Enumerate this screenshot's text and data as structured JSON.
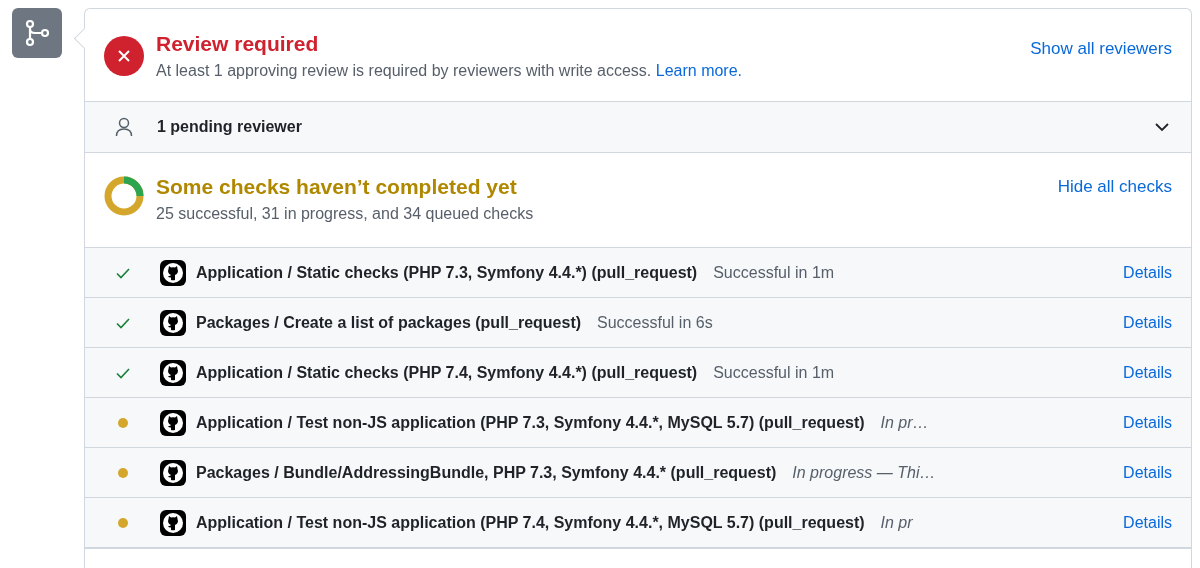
{
  "review": {
    "title": "Review required",
    "description": "At least 1 approving review is required by reviewers with write access.",
    "link": "Learn more.",
    "action": "Show all reviewers"
  },
  "pending": {
    "label": "1 pending reviewer",
    "expanded": false
  },
  "checks_summary": {
    "title": "Some checks haven’t completed yet",
    "description": "25 successful, 31 in progress, and 34 queued checks",
    "action": "Hide all checks"
  },
  "checks": [
    {
      "kind": "success",
      "name": "Application / Static checks (PHP 7.3, Symfony 4.4.*) (pull_request)",
      "detail": "Successful in 1m",
      "link": "Details"
    },
    {
      "kind": "success",
      "name": "Packages / Create a list of packages (pull_request)",
      "detail": "Successful in 6s",
      "link": "Details"
    },
    {
      "kind": "success",
      "name": "Application / Static checks (PHP 7.4, Symfony 4.4.*) (pull_request)",
      "detail": "Successful in 1m",
      "link": "Details"
    },
    {
      "kind": "in_progress",
      "name": "Application / Test non-JS application (PHP 7.3, Symfony 4.4.*, MySQL 5.7) (pull_request)",
      "detail": "In pr…",
      "link": "Details"
    },
    {
      "kind": "in_progress",
      "name": "Packages / Bundle/AddressingBundle, PHP 7.3, Symfony 4.4.* (pull_request)",
      "detail": "In progress — Thi…",
      "link": "Details"
    },
    {
      "kind": "in_progress",
      "name": "Application / Test non-JS application (PHP 7.4, Symfony 4.4.*, MySQL 5.7) (pull_request)",
      "detail": "In pr",
      "link": "Details"
    }
  ]
}
